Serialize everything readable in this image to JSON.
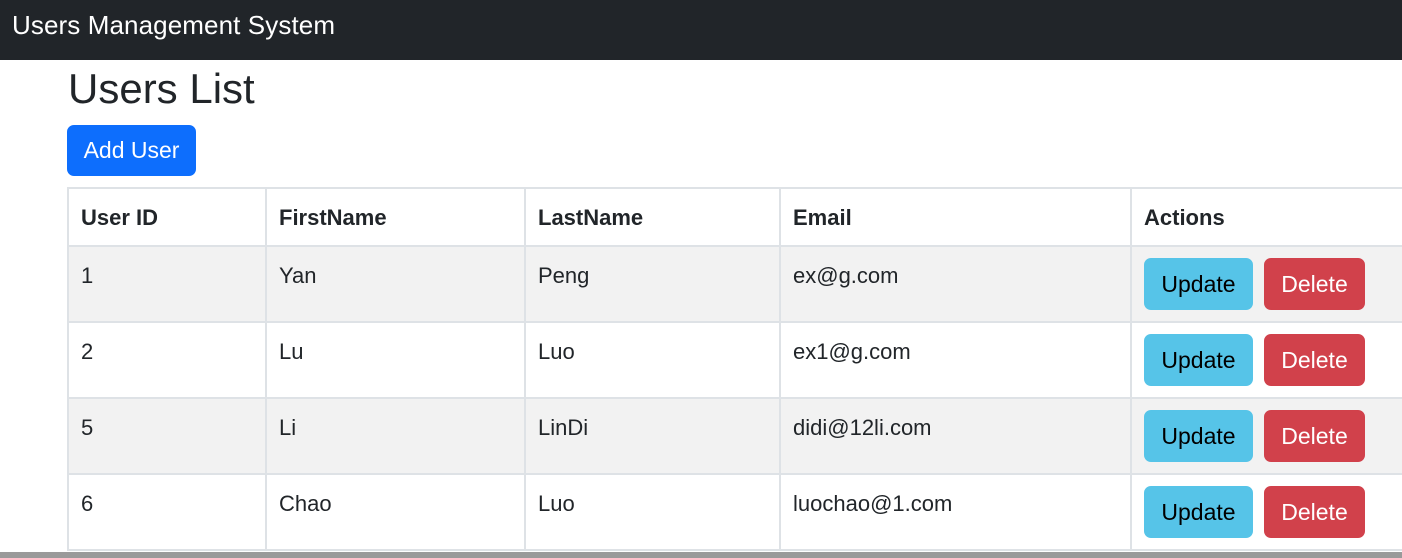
{
  "navbar": {
    "brand": "Users Management System"
  },
  "page": {
    "title": "Users List",
    "add_button_label": "Add User"
  },
  "table": {
    "columns": [
      "User ID",
      "FirstName",
      "LastName",
      "Email",
      "Actions"
    ],
    "rows": [
      {
        "id": "1",
        "first": "Yan",
        "last": "Peng",
        "email": "ex@g.com",
        "update_label": "Update",
        "delete_label": "Delete"
      },
      {
        "id": "2",
        "first": "Lu",
        "last": "Luo",
        "email": "ex1@g.com",
        "update_label": "Update",
        "delete_label": "Delete"
      },
      {
        "id": "5",
        "first": "Li",
        "last": "LinDi",
        "email": "didi@12li.com",
        "update_label": "Update",
        "delete_label": "Delete"
      },
      {
        "id": "6",
        "first": "Chao",
        "last": "Luo",
        "email": "luochao@1.com",
        "update_label": "Update",
        "delete_label": "Delete"
      }
    ]
  },
  "colors": {
    "navbar_bg": "#212529",
    "primary": "#0d6efd",
    "info": "#56c4e8",
    "danger": "#d1414b",
    "stripe": "#f2f2f2"
  }
}
